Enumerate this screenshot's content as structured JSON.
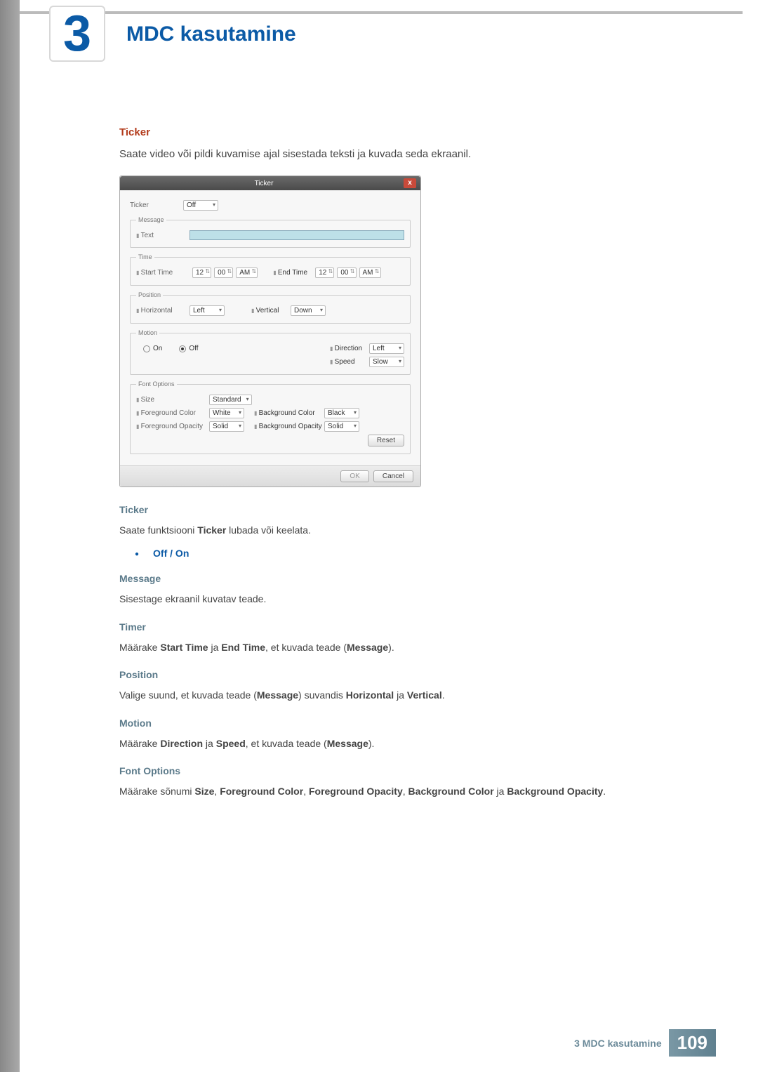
{
  "chapter": {
    "number": "3",
    "title": "MDC kasutamine"
  },
  "section": {
    "heading": "Ticker",
    "intro": "Saate video või pildi kuvamise ajal sisestada teksti ja kuvada seda ekraanil."
  },
  "dialog": {
    "title": "Ticker",
    "close": "x",
    "ticker": {
      "label": "Ticker",
      "value": "Off"
    },
    "message": {
      "legend": "Message",
      "text_label": "Text"
    },
    "time": {
      "legend": "Time",
      "start_label": "Start Time",
      "end_label": "End Time",
      "h1": "12",
      "m1": "00",
      "ap1": "AM",
      "h2": "12",
      "m2": "00",
      "ap2": "AM"
    },
    "position": {
      "legend": "Position",
      "horizontal_label": "Horizontal",
      "horizontal_value": "Left",
      "vertical_label": "Vertical",
      "vertical_value": "Down"
    },
    "motion": {
      "legend": "Motion",
      "on_label": "On",
      "off_label": "Off",
      "direction_label": "Direction",
      "direction_value": "Left",
      "speed_label": "Speed",
      "speed_value": "Slow"
    },
    "font": {
      "legend": "Font Options",
      "size_label": "Size",
      "size_value": "Standard",
      "fgcolor_label": "Foreground Color",
      "fgcolor_value": "White",
      "bgcolor_label": "Background Color",
      "bgcolor_value": "Black",
      "fgop_label": "Foreground Opacity",
      "fgop_value": "Solid",
      "bgop_label": "Background Opacity",
      "bgop_value": "Solid",
      "reset": "Reset"
    },
    "buttons": {
      "ok": "OK",
      "cancel": "Cancel"
    }
  },
  "body": {
    "ticker_h": "Ticker",
    "ticker_p_pre": "Saate funktsiooni ",
    "ticker_p_bold": "Ticker",
    "ticker_p_post": " lubada või keelata.",
    "off_on": "Off / On",
    "message_h": "Message",
    "message_p": "Sisestage ekraanil kuvatav teade.",
    "timer_h": "Timer",
    "timer_p_1": "Määrake ",
    "timer_p_b1": "Start Time",
    "timer_p_2": " ja ",
    "timer_p_b2": "End Time",
    "timer_p_3": ", et kuvada teade (",
    "timer_p_b3": "Message",
    "timer_p_4": ").",
    "position_h": "Position",
    "position_p_1": "Valige suund, et kuvada teade (",
    "position_p_b1": "Message",
    "position_p_2": ") suvandis ",
    "position_p_b2": "Horizontal",
    "position_p_3": " ja ",
    "position_p_b3": "Vertical",
    "position_p_4": ".",
    "motion_h": "Motion",
    "motion_p_1": "Määrake ",
    "motion_p_b1": "Direction",
    "motion_p_2": " ja ",
    "motion_p_b2": "Speed",
    "motion_p_3": ", et kuvada teade (",
    "motion_p_b3": "Message",
    "motion_p_4": ").",
    "font_h": "Font Options",
    "font_p_1": "Määrake sõnumi ",
    "font_p_b1": "Size",
    "font_p_2": ", ",
    "font_p_b2": "Foreground Color",
    "font_p_3": ", ",
    "font_p_b3": "Foreground Opacity",
    "font_p_4": ", ",
    "font_p_b4": "Background Color",
    "font_p_5": " ja ",
    "font_p_b5": "Background Opacity",
    "font_p_6": "."
  },
  "footer": {
    "text": "3 MDC kasutamine",
    "page": "109"
  }
}
